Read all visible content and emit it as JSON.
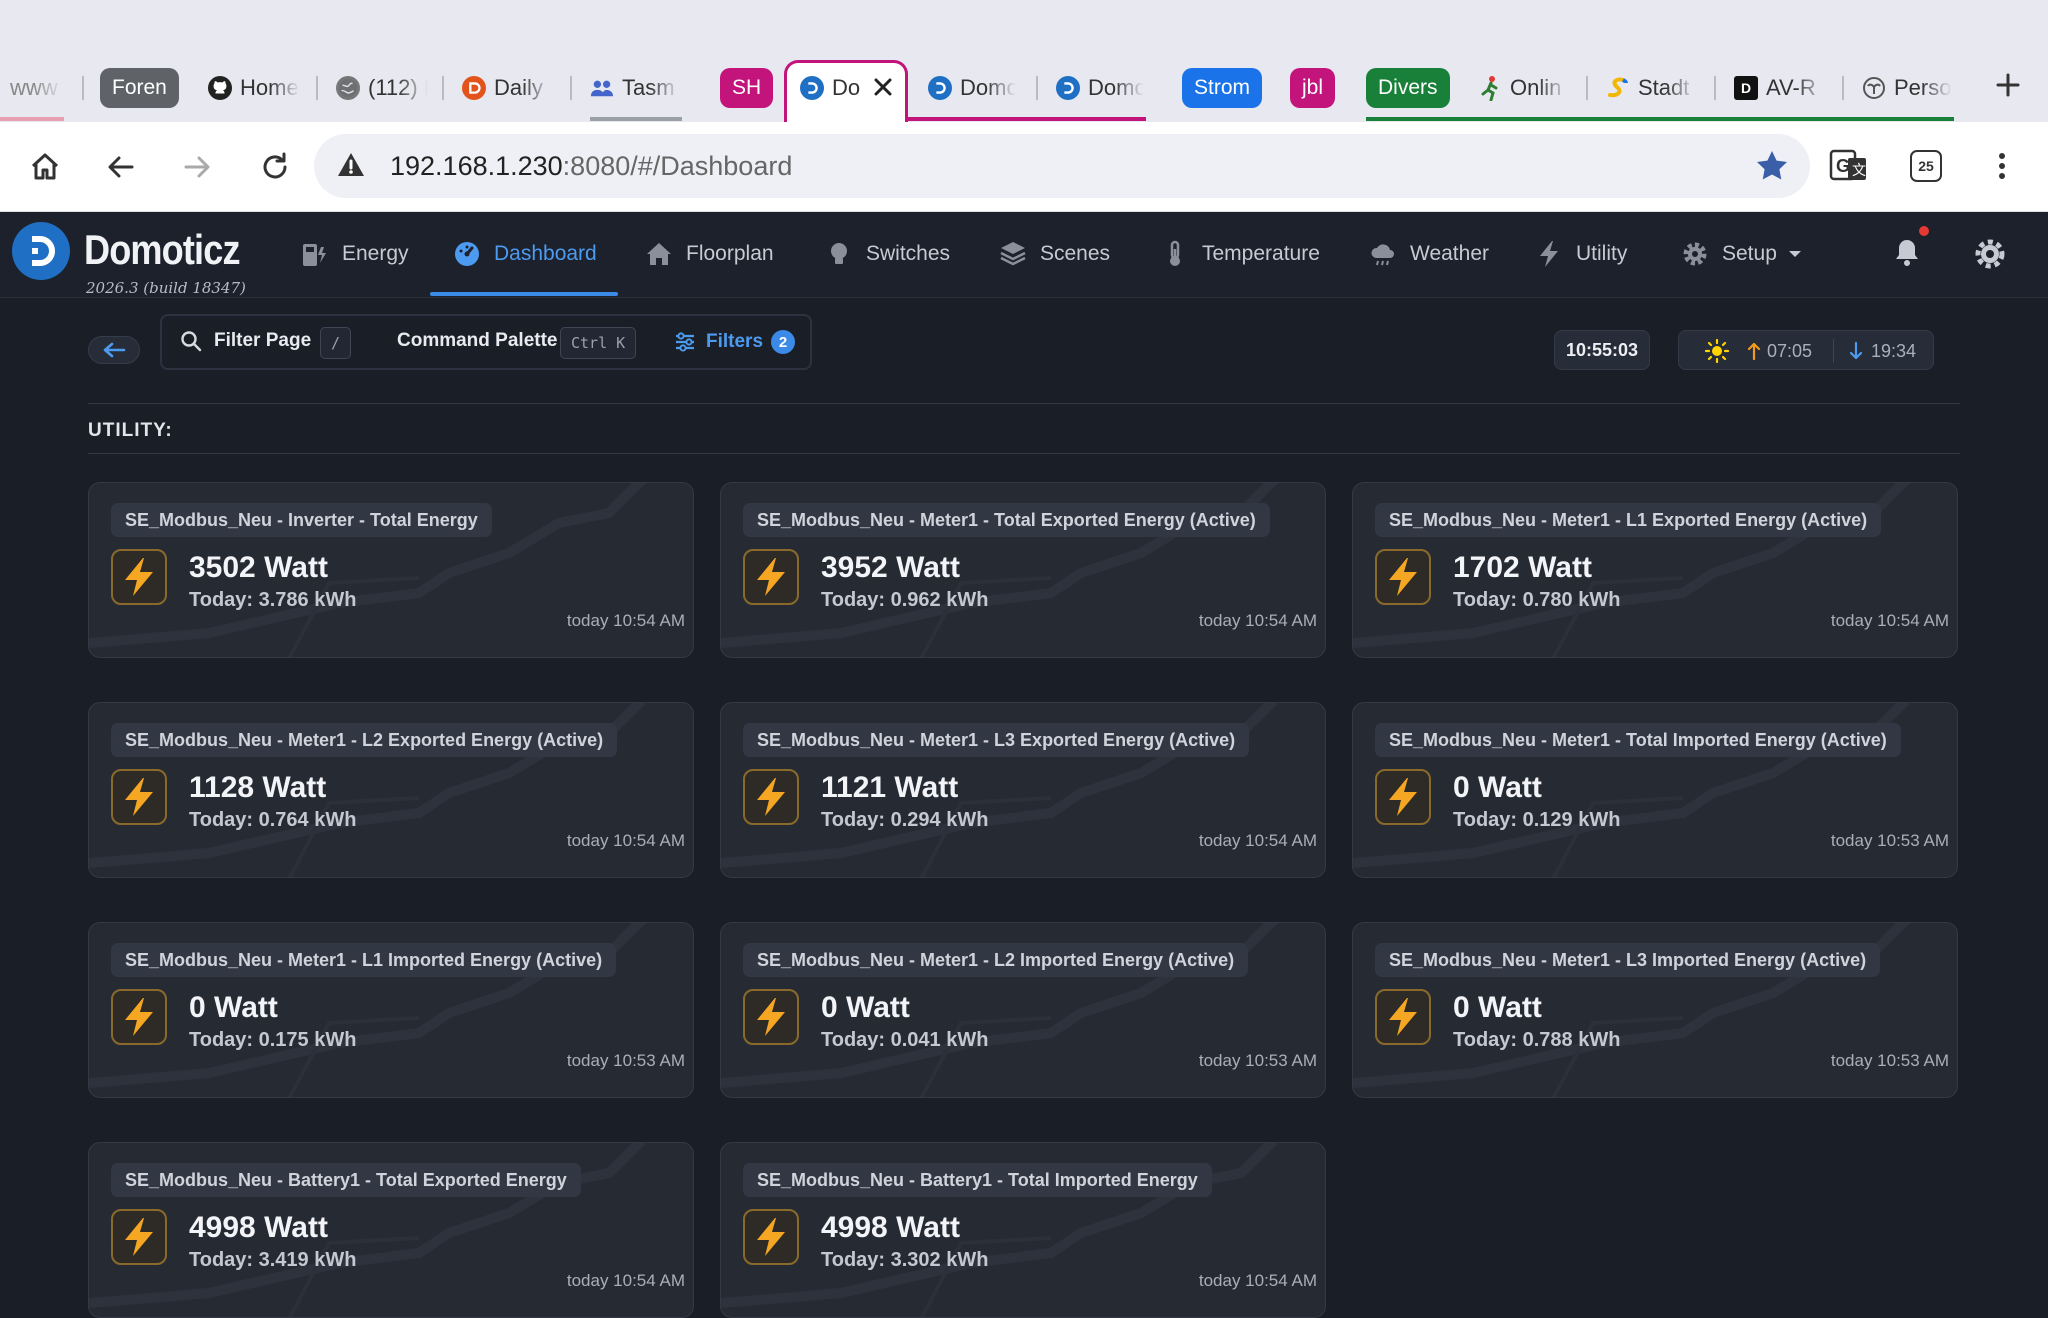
{
  "browser": {
    "tabs": [
      {
        "title": "www",
        "favicon": "globe-icon"
      },
      {
        "title": "Home",
        "favicon": "github-icon"
      },
      {
        "title": "(112) F",
        "favicon": "globe-icon"
      },
      {
        "title": "Daily",
        "favicon": "daily-icon"
      },
      {
        "title": "Tasm",
        "favicon": "people-icon"
      },
      {
        "title": "Do",
        "favicon": "domoticz-icon"
      },
      {
        "title": "Domo",
        "favicon": "domoticz-icon"
      },
      {
        "title": "Domo",
        "favicon": "domoticz-icon"
      },
      {
        "title": "Onlin",
        "favicon": "runner-icon"
      },
      {
        "title": "Stadt",
        "favicon": "stadt-icon"
      },
      {
        "title": "AV-R",
        "favicon": "d-icon"
      },
      {
        "title": "Perso",
        "favicon": "person-icon"
      }
    ],
    "tab_groups": [
      {
        "label": "Foren",
        "color": "#5f6368"
      },
      {
        "label": "SH",
        "color": "#c2147a"
      },
      {
        "label": "Strom",
        "color": "#1a73e8"
      },
      {
        "label": "jbl",
        "color": "#c2147a"
      },
      {
        "label": "Divers",
        "color": "#188038"
      }
    ],
    "url_host": "192.168.1.230",
    "url_rest": ":8080/#/Dashboard",
    "ext_badge": "25"
  },
  "app": {
    "brand": "Domoticz",
    "build": "2026.3 (build 18347)",
    "nav": [
      {
        "label": "Energy",
        "icon": "energy-meter-icon"
      },
      {
        "label": "Dashboard",
        "icon": "dashboard-icon",
        "active": true
      },
      {
        "label": "Floorplan",
        "icon": "home-icon"
      },
      {
        "label": "Switches",
        "icon": "bulb-icon"
      },
      {
        "label": "Scenes",
        "icon": "layers-icon"
      },
      {
        "label": "Temperature",
        "icon": "thermometer-icon"
      },
      {
        "label": "Weather",
        "icon": "cloud-icon"
      },
      {
        "label": "Utility",
        "icon": "bolt-icon"
      },
      {
        "label": "Setup",
        "icon": "gear-icon"
      }
    ],
    "accent": "#3b8ae8"
  },
  "toolbar": {
    "filter_page": "Filter Page",
    "filter_key": "/",
    "command_palette": "Command Palette",
    "command_key": "Ctrl K",
    "filters": "Filters",
    "filters_count": "2",
    "time": "10:55:03",
    "sunrise": "07:05",
    "sunset": "19:34"
  },
  "section": "UTILITY:",
  "cards": [
    {
      "title": "SE_Modbus_Neu - Inverter - Total Energy",
      "value": "3502 Watt",
      "today": "Today: 3.786 kWh",
      "time": "today 10:54 AM"
    },
    {
      "title": "SE_Modbus_Neu - Meter1 - Total Exported Energy (Active)",
      "value": "3952 Watt",
      "today": "Today: 0.962 kWh",
      "time": "today 10:54 AM"
    },
    {
      "title": "SE_Modbus_Neu - Meter1 - L1 Exported Energy (Active)",
      "value": "1702 Watt",
      "today": "Today: 0.780 kWh",
      "time": "today 10:54 AM"
    },
    {
      "title": "SE_Modbus_Neu - Meter1 - L2 Exported Energy (Active)",
      "value": "1128 Watt",
      "today": "Today: 0.764 kWh",
      "time": "today 10:54 AM"
    },
    {
      "title": "SE_Modbus_Neu - Meter1 - L3 Exported Energy (Active)",
      "value": "1121 Watt",
      "today": "Today: 0.294 kWh",
      "time": "today 10:54 AM"
    },
    {
      "title": "SE_Modbus_Neu - Meter1 - Total Imported Energy (Active)",
      "value": "0 Watt",
      "today": "Today: 0.129 kWh",
      "time": "today 10:53 AM"
    },
    {
      "title": "SE_Modbus_Neu - Meter1 - L1 Imported Energy (Active)",
      "value": "0 Watt",
      "today": "Today: 0.175 kWh",
      "time": "today 10:53 AM"
    },
    {
      "title": "SE_Modbus_Neu - Meter1 - L2 Imported Energy (Active)",
      "value": "0 Watt",
      "today": "Today: 0.041 kWh",
      "time": "today 10:53 AM"
    },
    {
      "title": "SE_Modbus_Neu - Meter1 - L3 Imported Energy (Active)",
      "value": "0 Watt",
      "today": "Today: 0.788 kWh",
      "time": "today 10:53 AM"
    },
    {
      "title": "SE_Modbus_Neu - Battery1 - Total Exported Energy",
      "value": "4998 Watt",
      "today": "Today: 3.419 kWh",
      "time": "today 10:54 AM"
    },
    {
      "title": "SE_Modbus_Neu - Battery1 - Total Imported Energy",
      "value": "4998 Watt",
      "today": "Today: 3.302 kWh",
      "time": "today 10:54 AM"
    }
  ]
}
